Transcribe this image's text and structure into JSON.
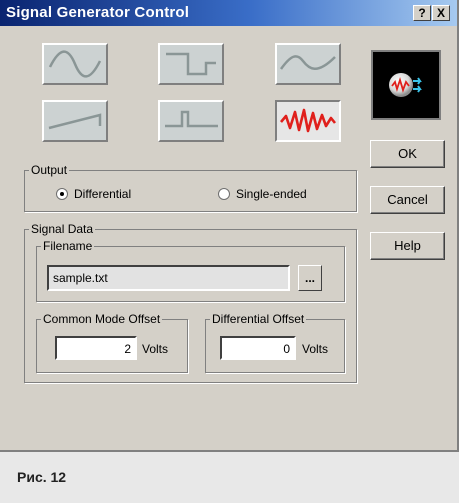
{
  "window": {
    "title": "Signal Generator Control",
    "help_glyph": "?",
    "close_glyph": "X"
  },
  "waveforms": [
    {
      "name": "sine",
      "selected": false
    },
    {
      "name": "square",
      "selected": false
    },
    {
      "name": "triangle",
      "selected": false
    },
    {
      "name": "ramp",
      "selected": false
    },
    {
      "name": "pulse",
      "selected": false
    },
    {
      "name": "noise",
      "selected": true
    }
  ],
  "preview": {
    "icon": "noise-signal-icon"
  },
  "buttons": {
    "ok": "OK",
    "cancel": "Cancel",
    "help": "Help"
  },
  "output": {
    "label": "Output",
    "options": [
      {
        "label": "Differential",
        "selected": true
      },
      {
        "label": "Single-ended",
        "selected": false
      }
    ]
  },
  "signal_data": {
    "label": "Signal Data",
    "filename": {
      "label": "Filename",
      "value": "sample.txt",
      "browse_label": "..."
    },
    "common_mode": {
      "label": "Common Mode Offset",
      "value": "2",
      "unit": "Volts"
    },
    "differential": {
      "label": "Differential Offset",
      "value": "0",
      "unit": "Volts"
    }
  },
  "caption": "Рис. 12",
  "colors": {
    "noise_wave": "#e0201c",
    "wave_gray": "#8a9696",
    "preview_bg": "#000000"
  }
}
